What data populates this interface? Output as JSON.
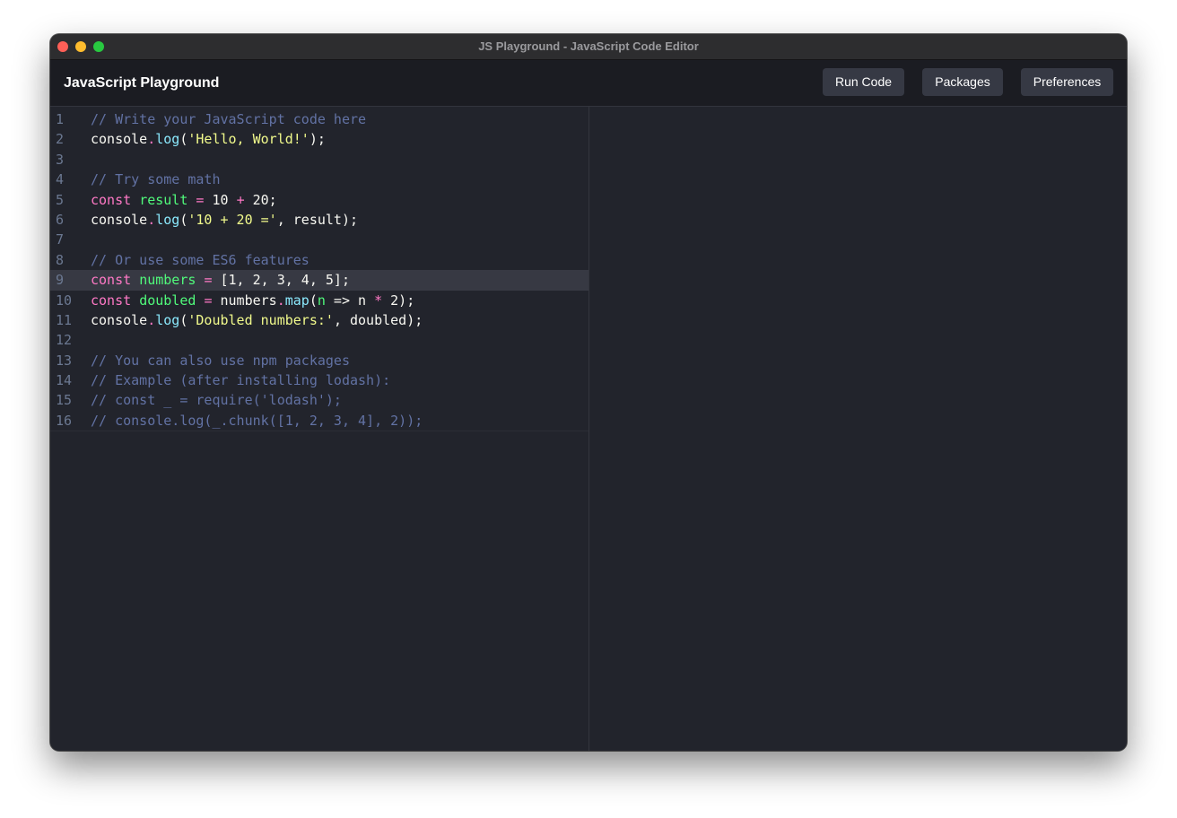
{
  "window": {
    "title": "JS Playground - JavaScript Code Editor"
  },
  "header": {
    "app_title": "JavaScript Playground",
    "buttons": {
      "run": "Run Code",
      "packages": "Packages",
      "preferences": "Preferences"
    }
  },
  "editor": {
    "active_line": 9,
    "lines": [
      {
        "num": "1",
        "tokens": [
          {
            "t": "// Write your JavaScript code here",
            "c": "c"
          }
        ]
      },
      {
        "num": "2",
        "tokens": [
          {
            "t": "console"
          },
          {
            "t": ".",
            "c": "o"
          },
          {
            "t": "log",
            "c": "f"
          },
          {
            "t": "("
          },
          {
            "t": "'Hello, World!'",
            "c": "s"
          },
          {
            "t": ");"
          }
        ]
      },
      {
        "num": "3",
        "tokens": []
      },
      {
        "num": "4",
        "tokens": [
          {
            "t": "// Try some math",
            "c": "c"
          }
        ]
      },
      {
        "num": "5",
        "tokens": [
          {
            "t": "const",
            "c": "k"
          },
          {
            "t": " "
          },
          {
            "t": "result",
            "c": "v"
          },
          {
            "t": " "
          },
          {
            "t": "=",
            "c": "o"
          },
          {
            "t": " 10 "
          },
          {
            "t": "+",
            "c": "o"
          },
          {
            "t": " 20;"
          }
        ]
      },
      {
        "num": "6",
        "tokens": [
          {
            "t": "console"
          },
          {
            "t": ".",
            "c": "o"
          },
          {
            "t": "log",
            "c": "f"
          },
          {
            "t": "("
          },
          {
            "t": "'10 + 20 ='",
            "c": "s"
          },
          {
            "t": ", result);"
          }
        ]
      },
      {
        "num": "7",
        "tokens": []
      },
      {
        "num": "8",
        "tokens": [
          {
            "t": "// Or use some ES6 features",
            "c": "c"
          }
        ]
      },
      {
        "num": "9",
        "tokens": [
          {
            "t": "const",
            "c": "k"
          },
          {
            "t": " "
          },
          {
            "t": "numbers",
            "c": "v"
          },
          {
            "t": " "
          },
          {
            "t": "=",
            "c": "o"
          },
          {
            "t": " [1, 2, 3, 4, 5];"
          }
        ]
      },
      {
        "num": "10",
        "tokens": [
          {
            "t": "const",
            "c": "k"
          },
          {
            "t": " "
          },
          {
            "t": "doubled",
            "c": "v"
          },
          {
            "t": " "
          },
          {
            "t": "=",
            "c": "o"
          },
          {
            "t": " numbers"
          },
          {
            "t": ".",
            "c": "o"
          },
          {
            "t": "map",
            "c": "f"
          },
          {
            "t": "("
          },
          {
            "t": "n",
            "c": "v"
          },
          {
            "t": " => n "
          },
          {
            "t": "*",
            "c": "o"
          },
          {
            "t": " 2);"
          }
        ]
      },
      {
        "num": "11",
        "tokens": [
          {
            "t": "console"
          },
          {
            "t": ".",
            "c": "o"
          },
          {
            "t": "log",
            "c": "f"
          },
          {
            "t": "("
          },
          {
            "t": "'Doubled numbers:'",
            "c": "s"
          },
          {
            "t": ", doubled);"
          }
        ]
      },
      {
        "num": "12",
        "tokens": []
      },
      {
        "num": "13",
        "tokens": [
          {
            "t": "// You can also use npm packages",
            "c": "c"
          }
        ]
      },
      {
        "num": "14",
        "tokens": [
          {
            "t": "// Example (after installing lodash):",
            "c": "c"
          }
        ]
      },
      {
        "num": "15",
        "tokens": [
          {
            "t": "// const _ = require('lodash');",
            "c": "c"
          }
        ]
      },
      {
        "num": "16",
        "tokens": [
          {
            "t": "// console.log(_.chunk([1, 2, 3, 4], 2));",
            "c": "c"
          }
        ]
      }
    ]
  },
  "colors": {
    "comment": "#6272a4",
    "keyword": "#ff79c6",
    "variable": "#50fa7b",
    "function": "#8be9fd",
    "string": "#f1fa8c",
    "text": "#f8f8f2",
    "background": "#22242c"
  }
}
